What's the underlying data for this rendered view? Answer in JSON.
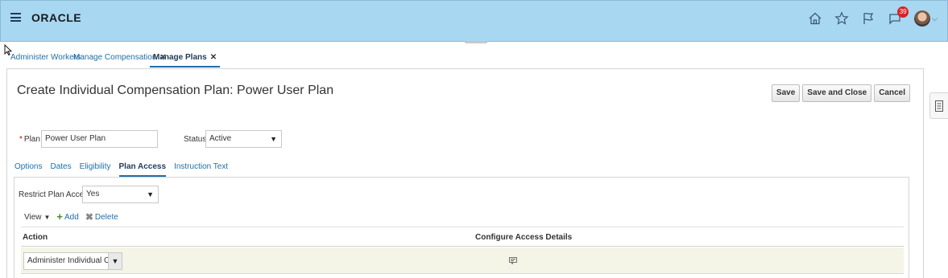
{
  "header": {
    "logo": "ORACLE",
    "notifications_count": "39",
    "icons": [
      "home-icon",
      "star-icon",
      "flag-icon",
      "notifications-icon",
      "user-avatar"
    ]
  },
  "nav_tabs": [
    {
      "label": "Administer Workers",
      "closable": false,
      "active": false
    },
    {
      "label": "Manage Compensation",
      "closable": true,
      "active": false
    },
    {
      "label": "Manage Plans",
      "closable": true,
      "active": true
    }
  ],
  "page": {
    "title": "Create Individual Compensation Plan: Power User Plan",
    "buttons": {
      "save": "Save",
      "save_and_close": "Save and Close",
      "cancel": "Cancel"
    }
  },
  "form": {
    "plan_label": "Plan",
    "plan_value": "Power User Plan",
    "status_label": "Status",
    "status_value": "Active"
  },
  "sub_tabs": [
    {
      "label": "Options",
      "active": false
    },
    {
      "label": "Dates",
      "active": false
    },
    {
      "label": "Eligibility",
      "active": false
    },
    {
      "label": "Plan Access",
      "active": true
    },
    {
      "label": "Instruction Text",
      "active": false
    }
  ],
  "plan_access": {
    "restrict_label": "Restrict Plan Access",
    "restrict_value": "Yes",
    "toolbar": {
      "view": "View",
      "add": "Add",
      "delete": "Delete"
    },
    "columns": [
      "Action",
      "Configure Access Details"
    ],
    "rows": [
      {
        "action": "Administer Individual Compen",
        "configure_icon": "configure-details-icon"
      }
    ]
  },
  "colors": {
    "header_bg": "#a8d7f2",
    "link": "#1f6fa9",
    "row_highlight": "#f4f5e6",
    "badge": "#d82222"
  }
}
